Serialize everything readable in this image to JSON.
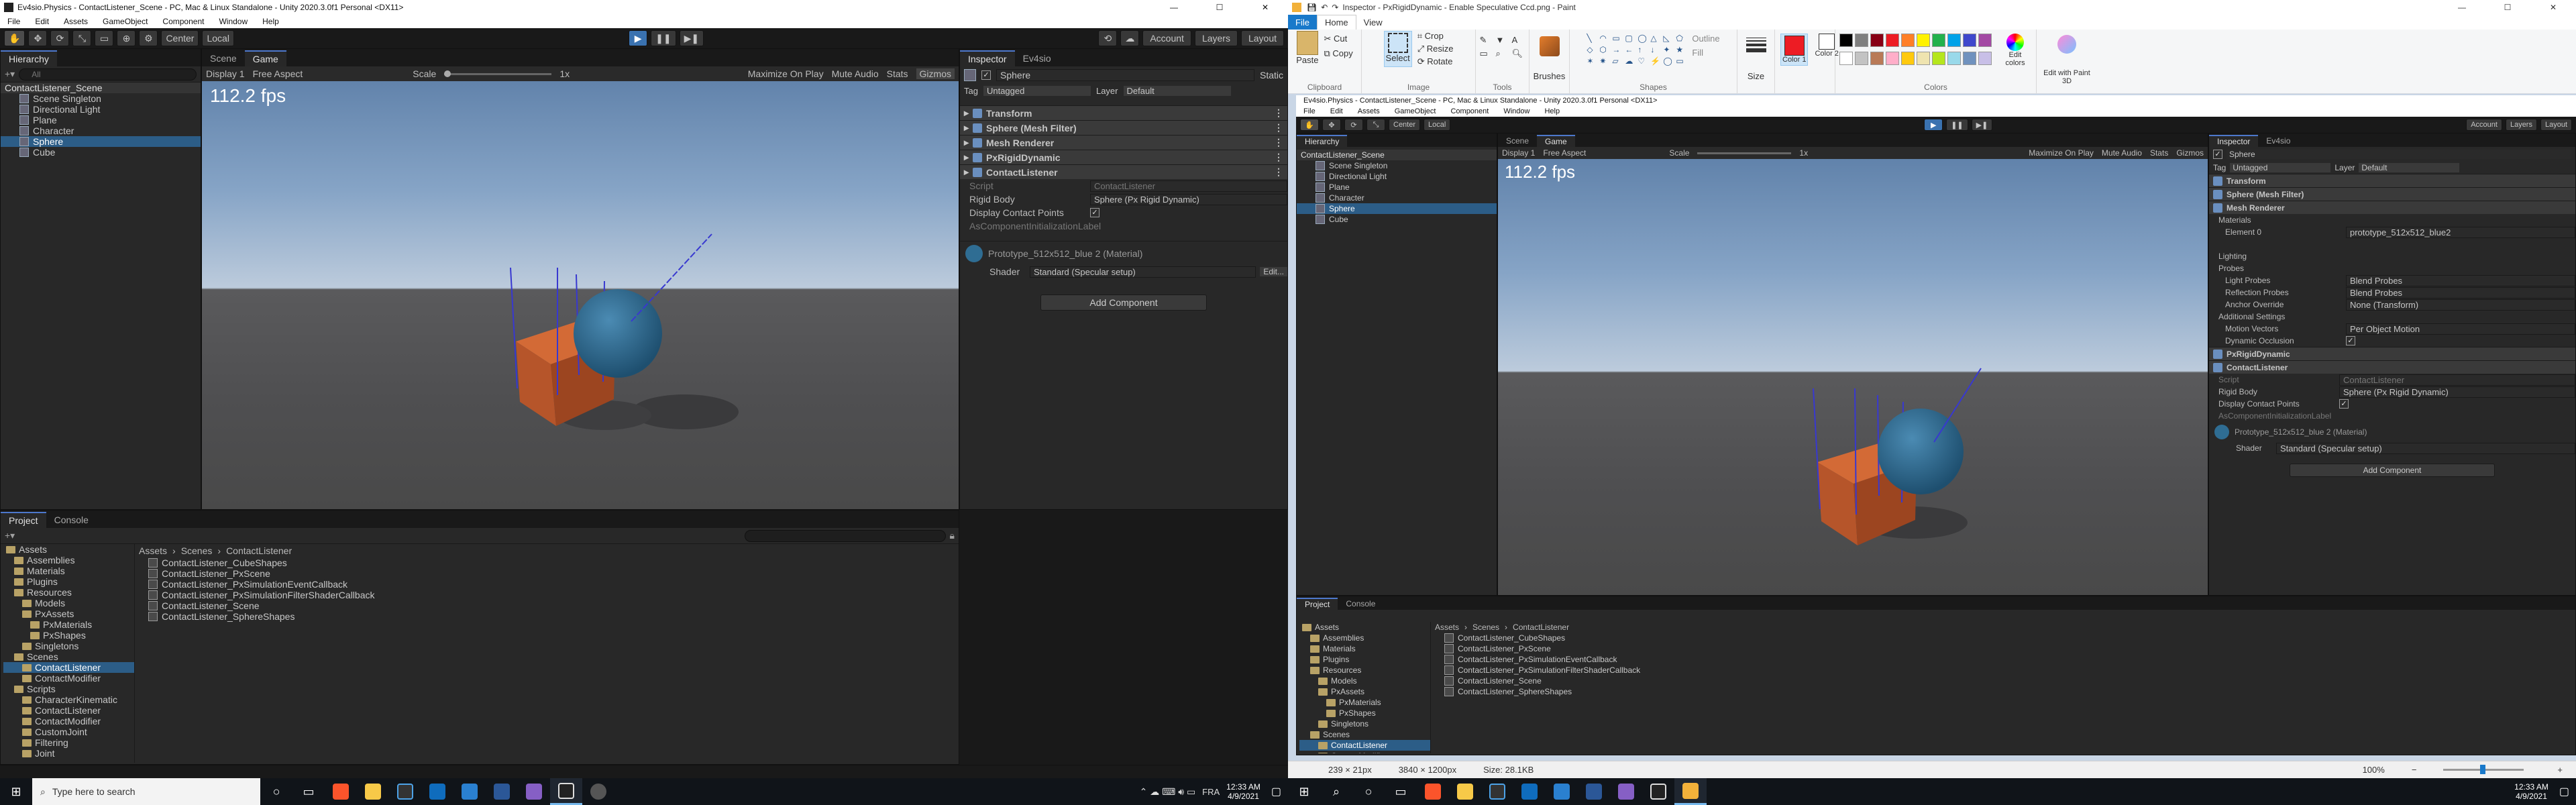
{
  "left_window": {
    "title": "Ev4sio.Physics - ContactListener_Scene - PC, Mac & Linux Standalone - Unity 2020.3.0f1 Personal <DX11>",
    "menu": [
      "File",
      "Edit",
      "Assets",
      "GameObject",
      "Component",
      "Window",
      "Help"
    ],
    "toolbar": {
      "center": "Center",
      "local": "Local",
      "account": "Account",
      "layers": "Layers",
      "layout": "Layout"
    },
    "hierarchy": {
      "tab": "Hierarchy",
      "search_placeholder": "All",
      "scene": "ContactListener_Scene",
      "items": [
        "Scene Singleton",
        "Directional Light",
        "Plane",
        "Character",
        "Sphere",
        "Cube"
      ],
      "selected": "Sphere"
    },
    "scene_tab": "Scene",
    "game_tab": "Game",
    "game_bar": {
      "display": "Display 1",
      "aspect": "Free Aspect",
      "scale": "Scale",
      "scale_value": "1x",
      "maximize": "Maximize On Play",
      "mute": "Mute Audio",
      "stats": "Stats",
      "gizmos": "Gizmos"
    },
    "fps": "112.2 fps",
    "inspector": {
      "tab": "Inspector",
      "tab2": "Ev4sio",
      "object": "Sphere",
      "static": "Static",
      "tag_label": "Tag",
      "tag": "Untagged",
      "layer_label": "Layer",
      "layer": "Default",
      "components": [
        "Transform",
        "Sphere (Mesh Filter)",
        "Mesh Renderer",
        "PxRigidDynamic",
        "ContactListener"
      ],
      "props": [
        {
          "k": "Script",
          "v": "ContactListener"
        },
        {
          "k": "Rigid Body",
          "v": "Sphere (Px Rigid Dynamic)"
        },
        {
          "k": "Display Contact Points",
          "v": "✓"
        },
        {
          "k": "AsComponentInitializationLabel",
          "v": ""
        }
      ],
      "material": "Prototype_512x512_blue 2 (Material)",
      "shader_label": "Shader",
      "shader": "Standard (Specular setup)",
      "edit": "Edit...",
      "add_component": "Add Component"
    },
    "project": {
      "tab": "Project",
      "console_tab": "Console",
      "folders": [
        "Assets",
        "Assemblies",
        "Materials",
        "Plugins",
        "Resources",
        "Models",
        "PxAssets",
        "PxMaterials",
        "PxShapes",
        "Singletons",
        "Scenes",
        "ContactListener",
        "ContactModifier",
        "Scripts",
        "CharacterKinematic",
        "ContactListener",
        "ContactModifier",
        "CustomJoint",
        "Filtering",
        "Joint"
      ],
      "breadcrumb": [
        "Assets",
        "Scenes",
        "ContactListener"
      ],
      "files": [
        "ContactListener_CubeShapes",
        "ContactListener_PxScene",
        "ContactListener_PxSimulationEventCallback",
        "ContactListener_PxSimulationFilterShaderCallback",
        "ContactListener_Scene",
        "ContactListener_SphereShapes"
      ]
    }
  },
  "paint_window": {
    "title": "Inspector - PxRigidDynamic - Enable Speculative Ccd.png - Paint",
    "tabs": [
      "File",
      "Home",
      "View"
    ],
    "groups": {
      "clipboard": "Clipboard",
      "paste": "Paste",
      "cut": "Cut",
      "copy": "Copy",
      "image": "Image",
      "select": "Select",
      "crop": "Crop",
      "resize": "Resize",
      "rotate": "Rotate",
      "tools": "Tools",
      "brushes": "Brushes",
      "shapes": "Shapes",
      "outline": "Outline",
      "fill": "Fill",
      "size": "Size",
      "color1": "Color 1",
      "color2": "Color 2",
      "colors": "Colors",
      "edit_colors": "Edit colors",
      "edit_paint3d": "Edit with Paint 3D"
    },
    "palette": [
      "#000000",
      "#7f7f7f",
      "#880015",
      "#ed1c24",
      "#ff7f27",
      "#fff200",
      "#22b14c",
      "#00a2e8",
      "#3f48cc",
      "#a349a4",
      "#ffffff",
      "#c3c3c3",
      "#b97a57",
      "#ffaec9",
      "#ffc90e",
      "#efe4b0",
      "#b5e61d",
      "#99d9ea",
      "#7092be",
      "#c8bfe7"
    ],
    "status": {
      "cursor": "239 × 21px",
      "dims": "3840 × 1200px",
      "size": "Size: 28.1KB",
      "zoom": "100%"
    },
    "inner": {
      "title": "Ev4sio.Physics - ContactListener_Scene - PC, Mac & Linux Standalone - Unity 2020.3.0f1 Personal <DX11>",
      "materials_label": "Materials",
      "element0": "Element 0",
      "material_value": "prototype_512x512_blue2",
      "lighting": "Lighting",
      "probes": "Probes",
      "light_probes": "Light Probes",
      "light_probes_v": "Blend Probes",
      "refl_probes": "Reflection Probes",
      "refl_probes_v": "Blend Probes",
      "anchor": "Anchor Override",
      "anchor_v": "None (Transform)",
      "additional": "Additional Settings",
      "motion": "Motion Vectors",
      "motion_v": "Per Object Motion",
      "occlusion": "Dynamic Occlusion",
      "occlusion_v": "✓"
    }
  },
  "taskbar": {
    "search_placeholder": "Type here to search",
    "lang": "FRA",
    "time_left": "12:33 AM",
    "date_left": "4/9/2021",
    "time_right": "12:33 AM",
    "date_right": "4/9/2021"
  },
  "colors": {
    "unity_bg": "#282828",
    "selection": "#2c5d87",
    "accent": "#4d78cc",
    "sky_top": "#5d7fa8",
    "floor": "#4f4f51",
    "cube": "#c0582a",
    "sphere": "#2f6d93"
  }
}
